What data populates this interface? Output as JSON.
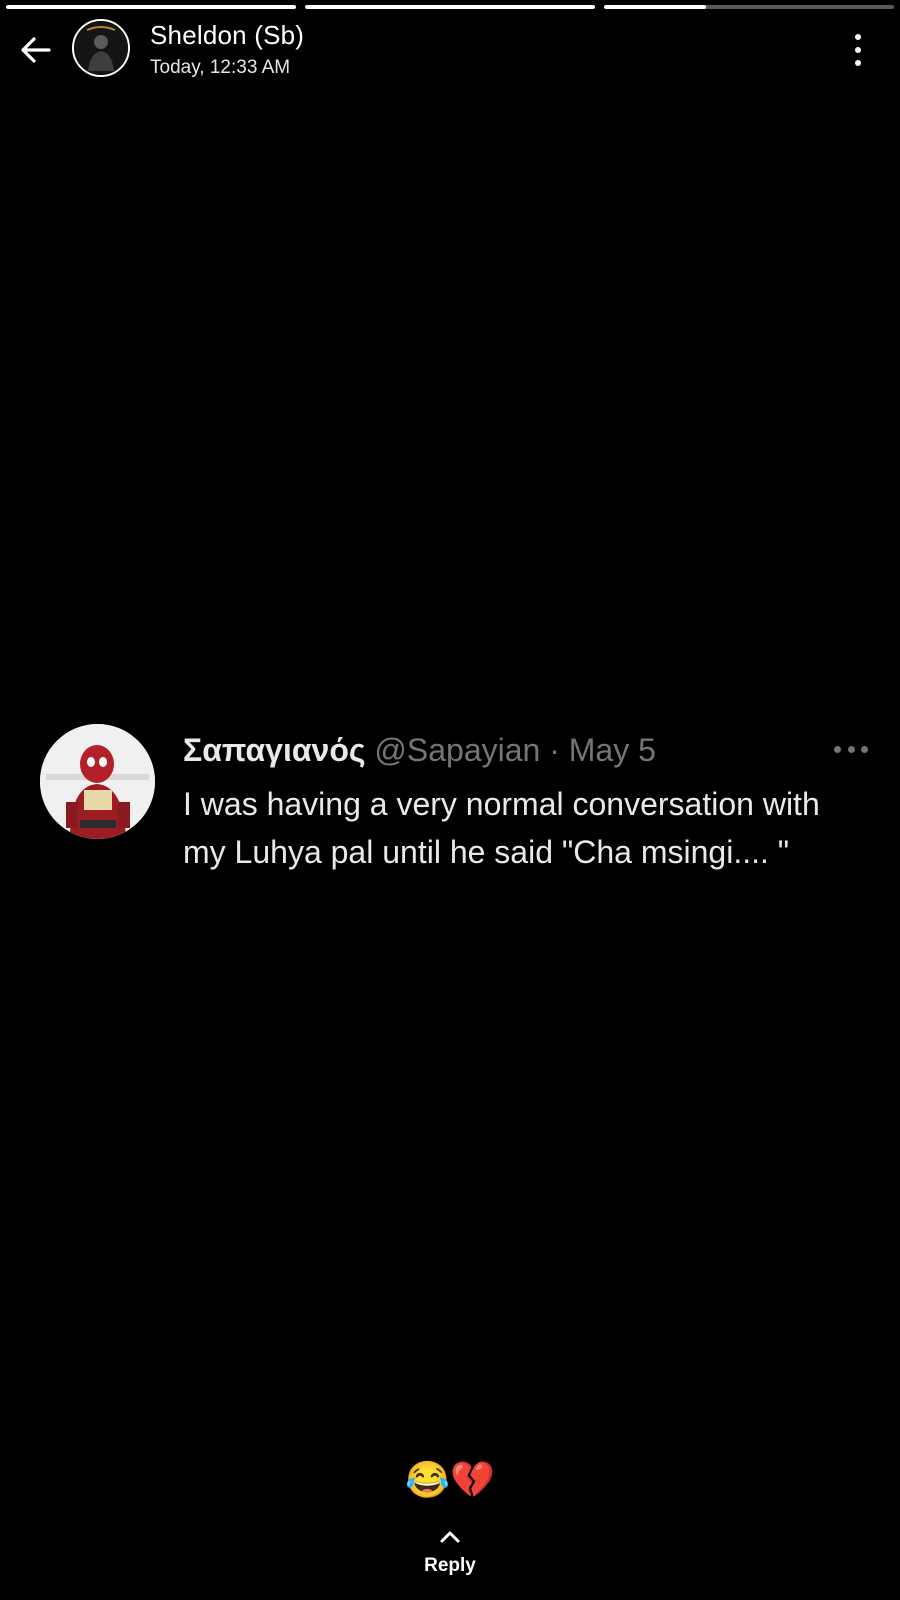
{
  "story": {
    "segments": [
      {
        "progress": 1.0
      },
      {
        "progress": 1.0
      },
      {
        "progress": 0.35
      }
    ]
  },
  "header": {
    "name": "Sheldon (Sb)",
    "time": "Today, 12:33 AM",
    "back_icon": "arrow-left-icon",
    "more_icon": "more-vertical-icon"
  },
  "tweet": {
    "display_name": "Σαπαγιανός",
    "handle": "@Sapayian",
    "separator": "·",
    "date": "May 5",
    "text": "I was having a very normal conversation with my Luhya pal until he said  \"Cha msingi.... \""
  },
  "reactions": "😂💔",
  "reply": {
    "label": "Reply",
    "icon": "chevron-up-icon"
  },
  "colors": {
    "background": "#000000",
    "text": "#ffffff",
    "tweet_text": "#e7e9ea",
    "tweet_muted": "#71767b"
  }
}
